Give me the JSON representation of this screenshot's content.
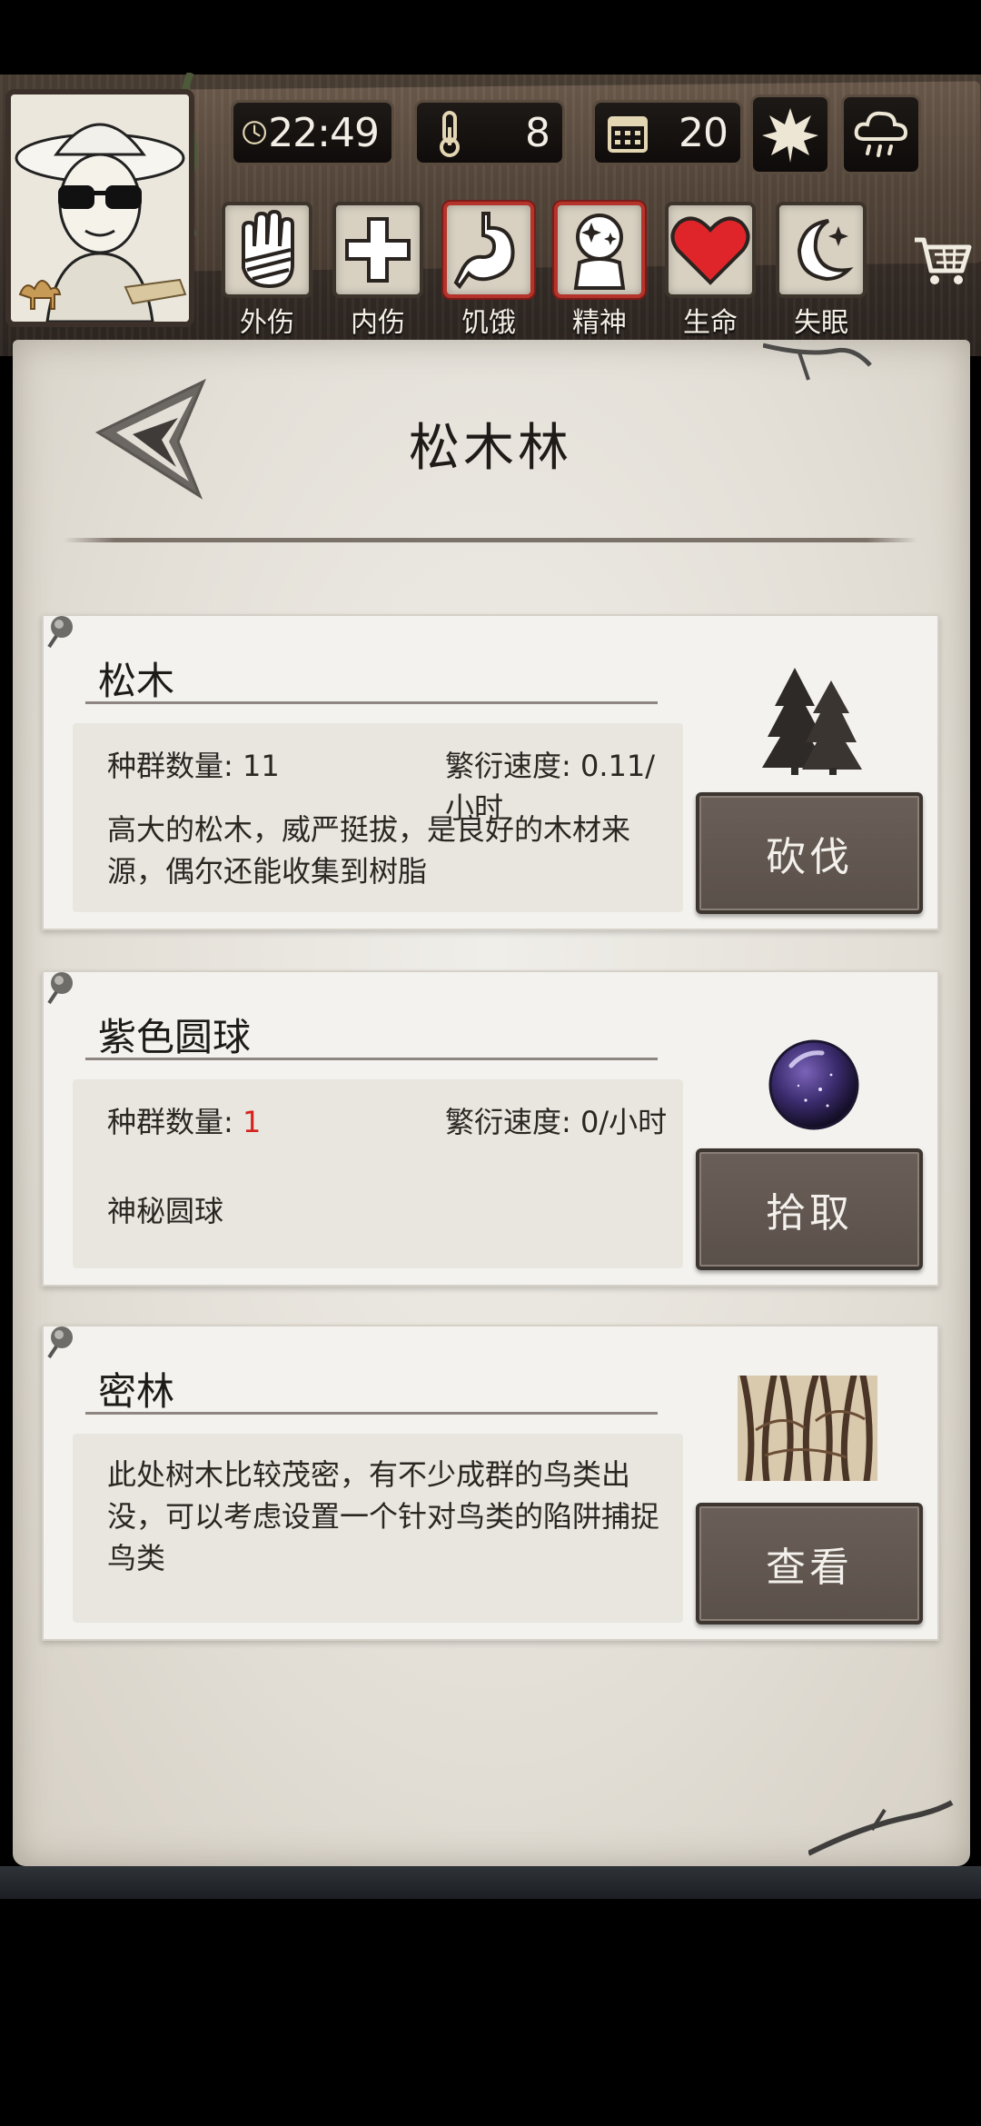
{
  "header": {
    "time": "22:49",
    "temperature": "8",
    "day": "20",
    "icons": {
      "clock": "clock-icon",
      "thermometer": "thermometer-icon",
      "calendar": "calendar-icon",
      "leaf": "maple-leaf-icon",
      "weather": "rain-cloud-icon"
    }
  },
  "stats": [
    {
      "label": "外伤",
      "icon": "bandaged-hand-icon",
      "alert": false
    },
    {
      "label": "内伤",
      "icon": "medical-cross-icon",
      "alert": false
    },
    {
      "label": "饥饿",
      "icon": "stomach-icon",
      "alert": true
    },
    {
      "label": "精神",
      "icon": "mind-icon",
      "alert": true
    },
    {
      "label": "生命",
      "icon": "heart-icon",
      "alert": false
    },
    {
      "label": "失眠",
      "icon": "moon-icon",
      "alert": false
    }
  ],
  "page": {
    "title": "松木林"
  },
  "cards": [
    {
      "name": "松木",
      "population_label": "种群数量: ",
      "population": "11",
      "rate_label": "繁衍速度: ",
      "rate": "0.11/小时",
      "description": "高大的松木，威严挺拔，是良好的木材来源，偶尔还能收集到树脂",
      "action": "砍伐",
      "art": "pine-trees-icon"
    },
    {
      "name": "紫色圆球",
      "population_label": "种群数量: ",
      "population": "1",
      "rate_label": "繁衍速度: ",
      "rate": "0/小时",
      "description": "神秘圆球",
      "action": "拾取",
      "art": "purple-orb-icon"
    },
    {
      "name": "密林",
      "description": "此处树木比较茂密，有不少成群的鸟类出没，可以考虑设置一个针对鸟类的陷阱捕捉鸟类",
      "action": "查看",
      "art": "dense-forest-icon"
    }
  ],
  "colors": {
    "alert_red": "#d4231c",
    "heart_red": "#e0252a",
    "button_brown": "#5e544e"
  }
}
